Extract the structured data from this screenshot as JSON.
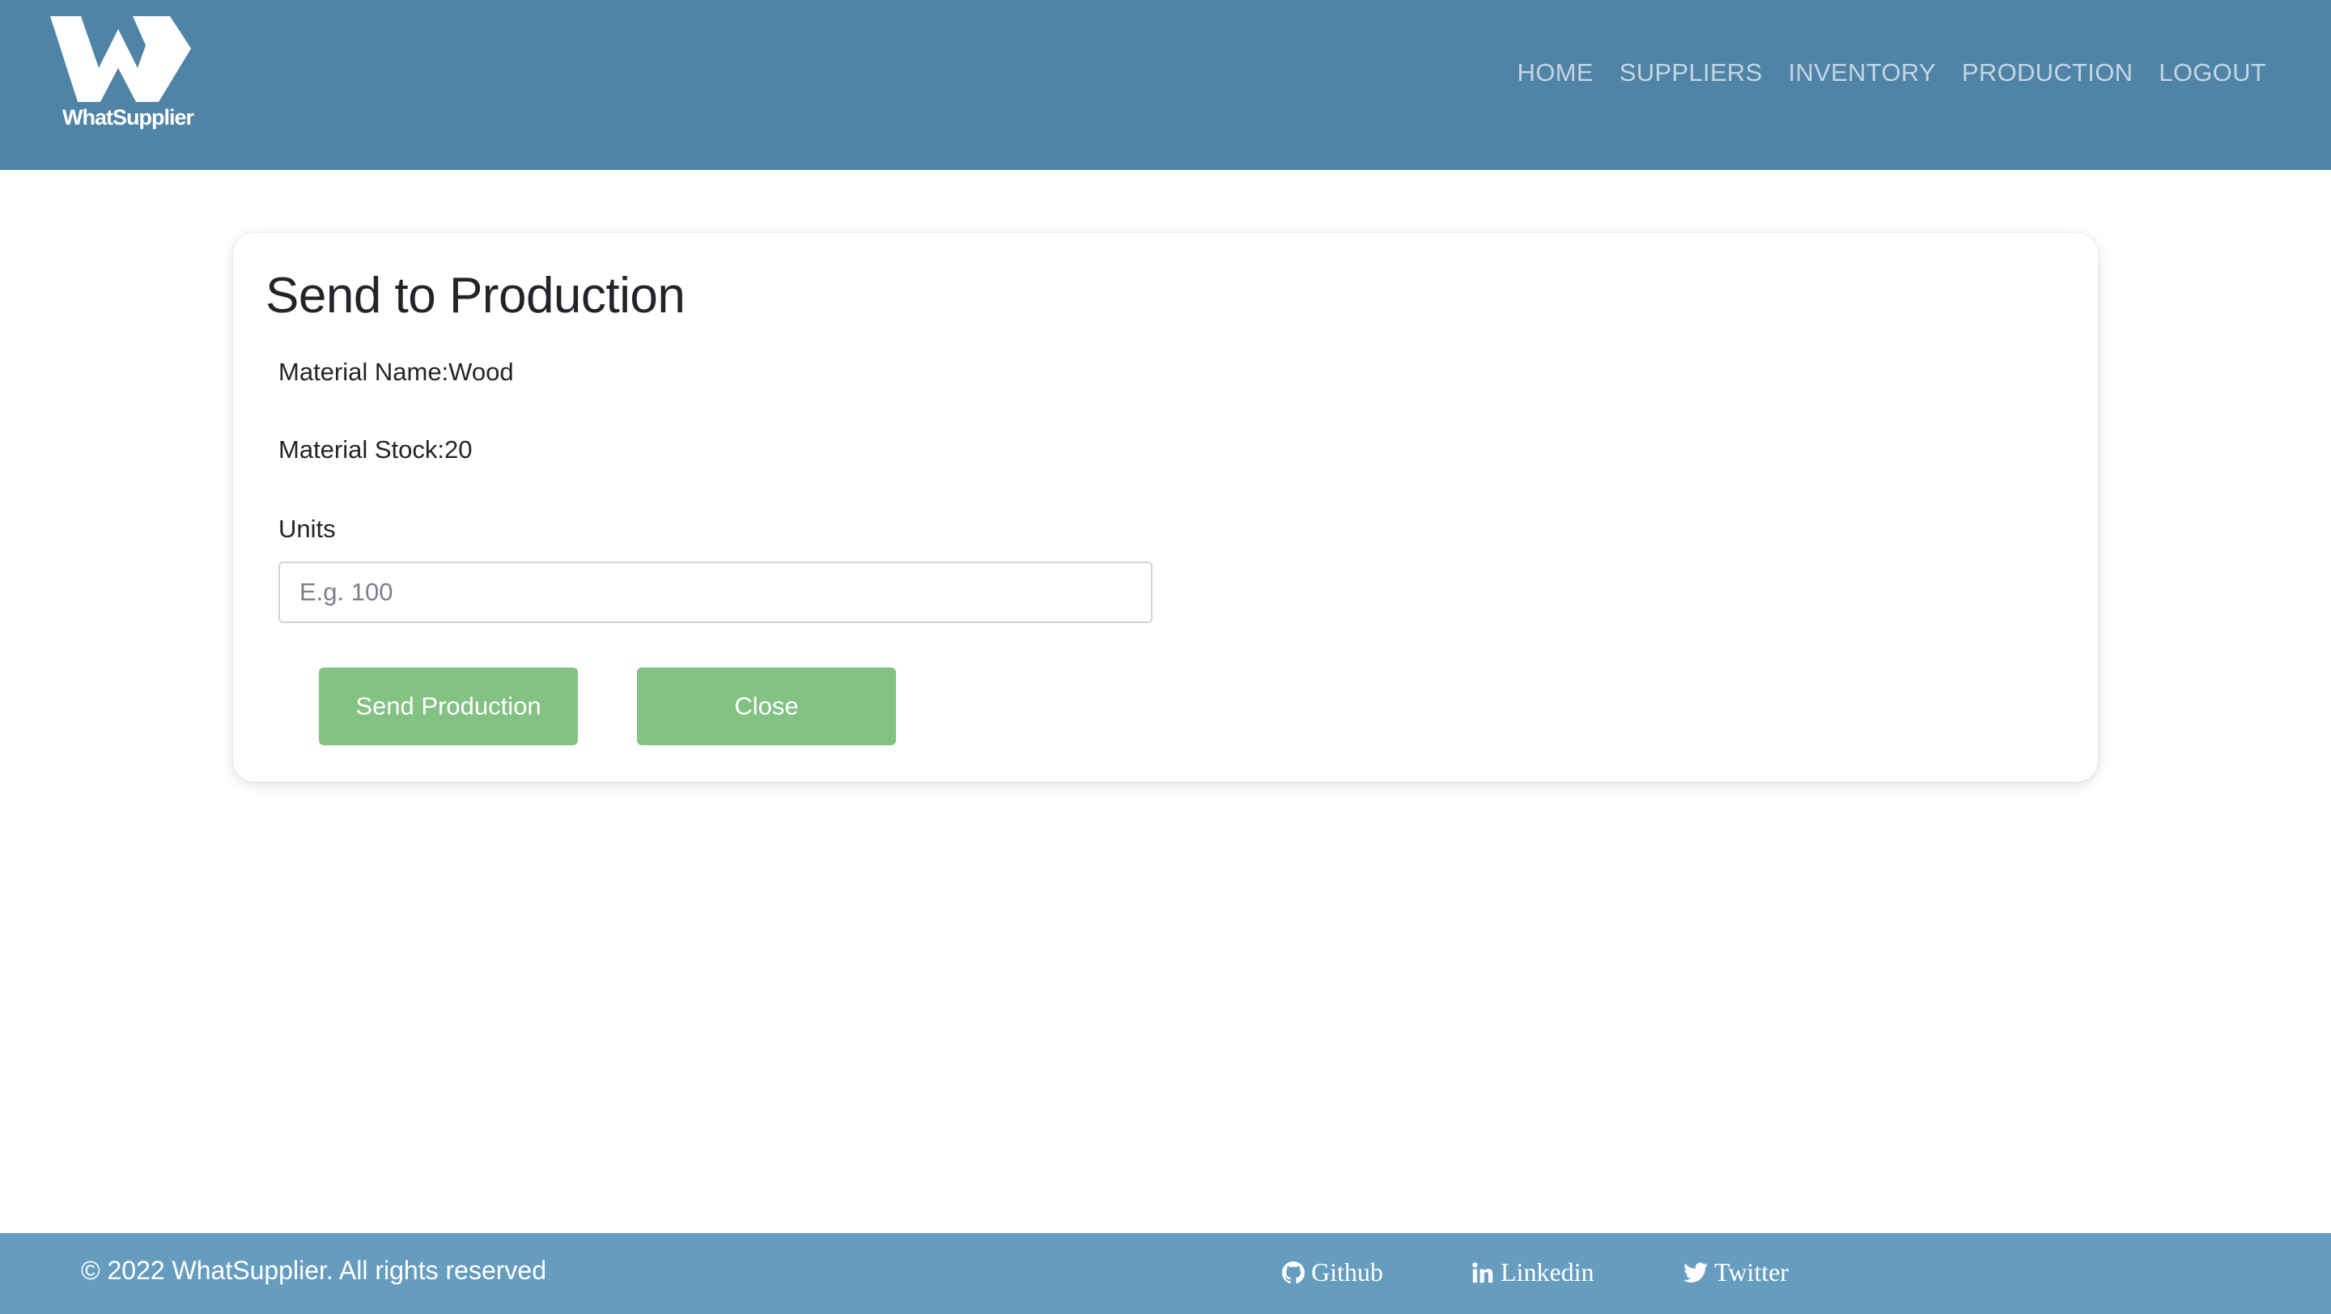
{
  "header": {
    "logo_text": "WhatSupplier",
    "nav": [
      {
        "label": "HOME"
      },
      {
        "label": "SUPPLIERS"
      },
      {
        "label": "INVENTORY"
      },
      {
        "label": "PRODUCTION"
      },
      {
        "label": "LOGOUT"
      }
    ]
  },
  "card": {
    "title": "Send to Production",
    "material_name": "Material Name:Wood",
    "material_stock": "Material Stock:20",
    "units_label": "Units",
    "units_placeholder": "E.g. 100",
    "units_value": "",
    "send_button": "Send Production",
    "close_button": "Close"
  },
  "footer": {
    "copyright": "© 2022 WhatSupplier. All rights reserved",
    "links": [
      {
        "label": "Github",
        "icon": "github-icon"
      },
      {
        "label": "Linkedin",
        "icon": "linkedin-icon"
      },
      {
        "label": "Twitter",
        "icon": "twitter-icon"
      }
    ]
  },
  "colors": {
    "header_bg": "#4f84a6",
    "footer_bg": "#669dbf",
    "button_bg": "#83c283",
    "nav_text": "#c5d5e4"
  }
}
